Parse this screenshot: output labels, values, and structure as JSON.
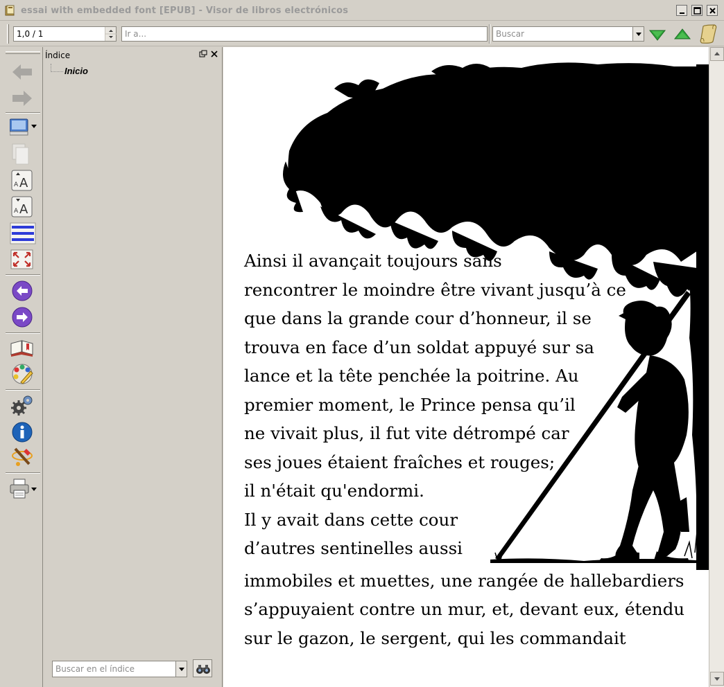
{
  "window": {
    "title": "essai with embedded font [EPUB] - Visor de libros electrónicos",
    "controls": [
      "minimize-icon",
      "maximize-icon",
      "close-icon"
    ]
  },
  "toolbar": {
    "position_value": "1,0 / 1",
    "goto_placeholder": "Ir a...",
    "search_placeholder": "Buscar",
    "icons": [
      "find-next-icon",
      "find-previous-icon",
      "reference-scroll-icon"
    ]
  },
  "sidebar": {
    "tools": [
      "back-icon",
      "forward-icon",
      "monitor-icon",
      "copy-icon",
      "font-size-larger-icon",
      "font-size-smaller-icon",
      "line-spacing-icon",
      "fullscreen-icon",
      "previous-page-icon",
      "next-page-icon",
      "bookmarks-icon",
      "theme-icon",
      "preferences-icon",
      "info-icon",
      "tweak-icon",
      "print-icon"
    ]
  },
  "toc": {
    "title": "Índice",
    "items": [
      {
        "label": "Inicio"
      }
    ],
    "search_placeholder": "Buscar en el índice"
  },
  "content": {
    "lines": [
      "Ainsi il avançait toujours sans",
      "rencontrer le moindre être vivant jusqu’à ce",
      "que dans la grande cour d’honneur, il se",
      "trouva en face d’un soldat appuyé sur sa",
      "lance et la tête penchée la poitrine. Au",
      "premier moment, le Prince pensa qu’il",
      "ne vivait plus, il fut vite détrompé car",
      "ses joues étaient fraîches et rouges;",
      "il n'était qu'endormi.",
      "Il y avait dans cette cour",
      "d’autres sentinelles aussi",
      "immobiles et muettes, une rangée de hallebardiers",
      "s’appuyaient contre un mur, et, devant eux, étendu",
      "sur le gazon, le sergent, qui les commandait"
    ],
    "illustration": "silhouette-illustration"
  },
  "colors": {
    "chrome": "#d4d0c8",
    "title_text": "#9a9a9a",
    "find_arrow": "#2fa33a",
    "nav_purple": "#6d3bb8",
    "info_blue": "#1e63b8"
  }
}
